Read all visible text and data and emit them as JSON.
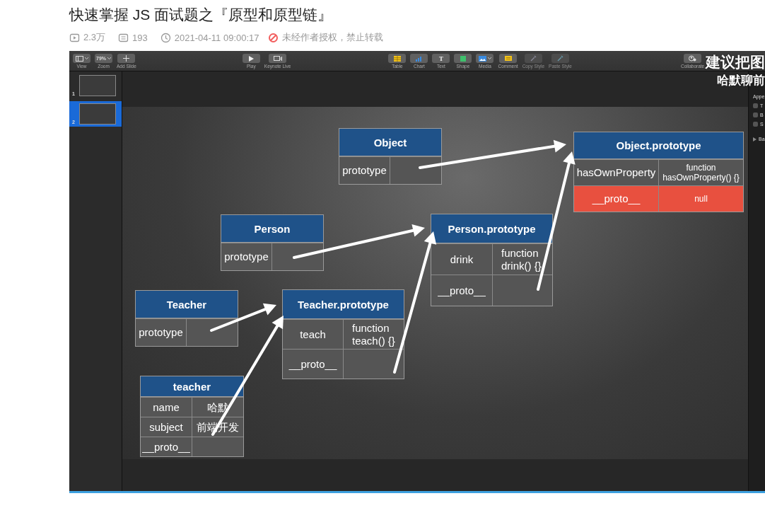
{
  "page": {
    "title": "快速掌握 JS 面试题之『原型和原型链』",
    "meta": [
      {
        "kind": "views",
        "text": "2.3万"
      },
      {
        "kind": "comments",
        "text": "193"
      },
      {
        "kind": "time",
        "text": "2021-04-11 09:00:17"
      },
      {
        "kind": "notice",
        "text": "未经作者授权，禁止转载"
      }
    ]
  },
  "video": {
    "subtitle": [
      "建议把图",
      "哈默聊前"
    ],
    "toolbar": {
      "groups": [
        [
          {
            "kind": "view",
            "label": "View",
            "disabled": false
          },
          {
            "kind": "zoom",
            "label": "Zoom",
            "value": "79%",
            "disabled": false
          },
          {
            "kind": "add",
            "label": "Add Slide",
            "disabled": false
          }
        ],
        [
          {
            "kind": "play",
            "label": "Play",
            "disabled": false
          },
          {
            "kind": "live",
            "label": "Keynote Live",
            "disabled": false
          }
        ],
        [
          {
            "kind": "table",
            "label": "Table",
            "disabled": false
          },
          {
            "kind": "chart",
            "label": "Chart",
            "disabled": false
          },
          {
            "kind": "text",
            "glyph": "T",
            "label": "Text",
            "disabled": false
          },
          {
            "kind": "shape",
            "label": "Shape",
            "disabled": false
          },
          {
            "kind": "media",
            "label": "Media",
            "disabled": false
          },
          {
            "kind": "comment",
            "label": "Comment",
            "disabled": false
          },
          {
            "kind": "copy",
            "label": "Copy Style",
            "disabled": true
          },
          {
            "kind": "paste",
            "label": "Paste Style",
            "disabled": true
          }
        ],
        [
          {
            "kind": "collab",
            "label": "Collaborate",
            "disabled": false
          }
        ]
      ]
    },
    "slides": [
      {
        "number": "1",
        "selected": false
      },
      {
        "number": "2",
        "selected": true
      }
    ],
    "tables": [
      {
        "title": "Object",
        "rows": [
          {
            "key": "prototype",
            "value": "",
            "highlighted": false
          }
        ]
      },
      {
        "title": "Object.prototype",
        "rows": [
          {
            "key": "hasOwnProperty",
            "value": "function hasOwnProperty() {}",
            "highlighted": false
          },
          {
            "key": "__proto__",
            "value": "null",
            "highlighted": true
          }
        ]
      },
      {
        "title": "Person",
        "rows": [
          {
            "key": "prototype",
            "value": "",
            "highlighted": false
          }
        ]
      },
      {
        "title": "Person.prototype",
        "rows": [
          {
            "key": "drink",
            "value": "function drink() {}",
            "highlighted": false
          },
          {
            "key": "__proto__",
            "value": "",
            "highlighted": false
          }
        ]
      },
      {
        "title": "Teacher",
        "rows": [
          {
            "key": "prototype",
            "value": "",
            "highlighted": false
          }
        ]
      },
      {
        "title": "Teacher.prototype",
        "rows": [
          {
            "key": "teach",
            "value": "function teach() {}",
            "highlighted": false
          },
          {
            "key": "__proto__",
            "value": "",
            "highlighted": false
          }
        ]
      },
      {
        "title": "teacher",
        "rows": [
          {
            "key": "name",
            "value": "哈默",
            "highlighted": false
          },
          {
            "key": "subject",
            "value": "前端开发",
            "highlighted": false
          },
          {
            "key": "__proto__",
            "value": "",
            "highlighted": false
          }
        ]
      }
    ],
    "inspector": {
      "heading": "Appe",
      "options": [
        {
          "label": "T",
          "checked": false
        },
        {
          "label": "B",
          "checked": false
        },
        {
          "label": "S",
          "checked": false
        }
      ],
      "section": "Ba"
    }
  }
}
